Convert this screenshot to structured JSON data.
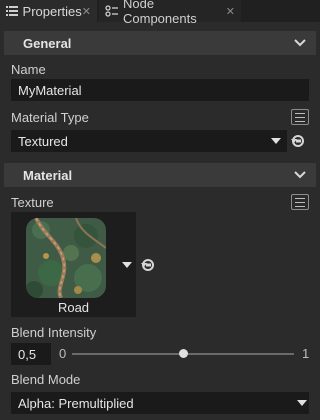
{
  "tabs": [
    {
      "label": "Properties",
      "icon": "list-icon",
      "active": true
    },
    {
      "label": "Node Components",
      "icon": "components-icon",
      "active": false
    }
  ],
  "sections": {
    "general": {
      "title": "General"
    },
    "material": {
      "title": "Material"
    }
  },
  "general": {
    "name_label": "Name",
    "name_value": "MyMaterial",
    "material_type_label": "Material Type",
    "material_type_value": "Textured"
  },
  "material": {
    "texture_label": "Texture",
    "texture_name": "Road",
    "blend_intensity_label": "Blend Intensity",
    "blend_intensity_value": "0,5",
    "slider_min": "0",
    "slider_max": "1",
    "slider_fraction": 0.5,
    "blend_mode_label": "Blend Mode",
    "blend_mode_value": "Alpha: Premultiplied"
  },
  "colors": {
    "background": "#2b2b2b",
    "section_header": "#3a3a3a",
    "field_background": "#1a1a1a",
    "tabbar": "#202020"
  }
}
